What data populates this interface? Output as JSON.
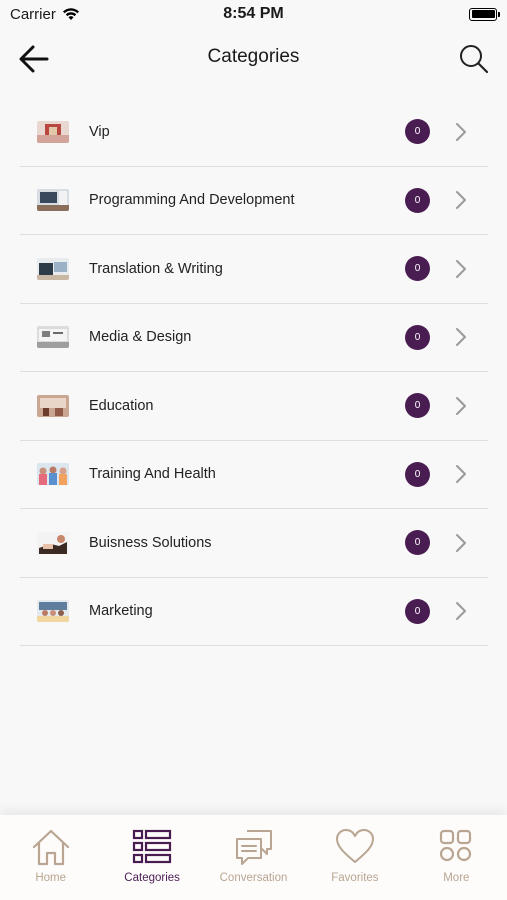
{
  "status_bar": {
    "carrier": "Carrier",
    "time": "8:54 PM"
  },
  "header": {
    "title": "Categories"
  },
  "categories": [
    {
      "label": "Vip",
      "count": "0",
      "thumb": "vip-thumbnail"
    },
    {
      "label": "Programming And Development",
      "count": "0",
      "thumb": "programming-thumbnail"
    },
    {
      "label": "Translation & Writing",
      "count": "0",
      "thumb": "translation-thumbnail"
    },
    {
      "label": "Media & Design",
      "count": "0",
      "thumb": "media-thumbnail"
    },
    {
      "label": "Education",
      "count": "0",
      "thumb": "education-thumbnail"
    },
    {
      "label": "Training And Health",
      "count": "0",
      "thumb": "health-thumbnail"
    },
    {
      "label": "Buisness Solutions",
      "count": "0",
      "thumb": "business-thumbnail"
    },
    {
      "label": "Marketing",
      "count": "0",
      "thumb": "marketing-thumbnail"
    }
  ],
  "tabs": [
    {
      "label": "Home",
      "icon": "home-icon"
    },
    {
      "label": "Categories",
      "icon": "list-icon",
      "active": true
    },
    {
      "label": "Conversation",
      "icon": "chat-icon"
    },
    {
      "label": "Favorites",
      "icon": "heart-icon"
    },
    {
      "label": "More",
      "icon": "grid-icon"
    }
  ],
  "colors": {
    "accent": "#4a1d52",
    "tab_inactive": "#b9a591",
    "badge": "#4a1d52"
  }
}
